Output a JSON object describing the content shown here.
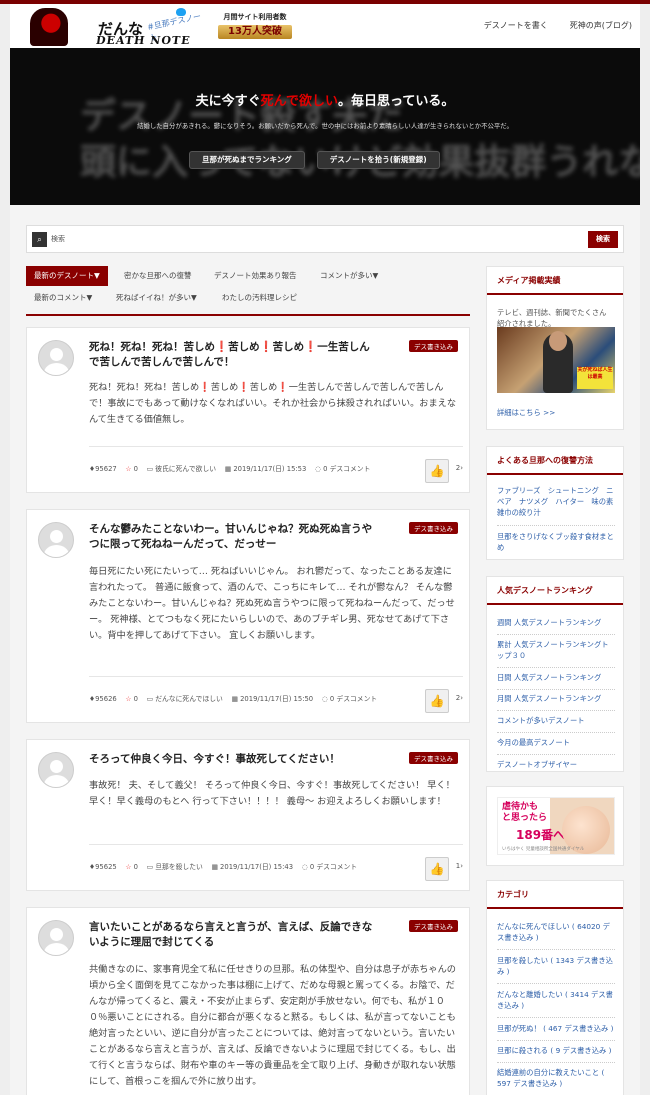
{
  "site": {
    "logo_line1": "だんな",
    "logo_line2": "DEATH NOTE",
    "logo_tag": "#旦那デスノート",
    "users_label": "月間サイト利用者数",
    "users_count": "13万人突破",
    "nav": [
      "デスノートを書く",
      "死神の声(ブログ)"
    ]
  },
  "hero": {
    "headline_pre": "夫に今すぐ",
    "headline_red": "死んで欲しい",
    "headline_post": "。毎日思っている。",
    "sub": "結婚した自分があきれる。鬱になりそう。お願いだから死んで。世の中にはお前より素晴らしい人達が生きられないとか不公平だ。",
    "ghost_line1": "デスノート殺す夫だ",
    "ghost_line2": "頭に入ってないけど効果抜群うれない",
    "btn_ranking": "旦那が死ぬまでランキング",
    "btn_register": "デスノートを拾う(新規登録)"
  },
  "search": {
    "placeholder": "検索",
    "button": "検索"
  },
  "tabs": [
    "最新のデスノート▼",
    "密かな旦那への復讐",
    "デスノート効果あり報告",
    "コメントが多い▼",
    "最新のコメント▼",
    "死ねばイイね！が多い▼",
    "わたしの汚料理レシピ"
  ],
  "posts": [
    {
      "title": "死ね！死ね！死ね！苦しめ❗苦しめ❗苦しめ❗一生苦しんで苦しんで苦しんで苦しんで！",
      "badge": "デス書き込み",
      "body": "死ね！死ね！死ね！苦しめ❗苦しめ❗苦しめ❗一生苦しんで苦しんで苦しんで苦しんで！事故にでもあって動けなくなればいい。それか社会から抹殺されればいい。おまえなんて生きてる価値無し。",
      "id": "95627",
      "stars": "0",
      "category": "彼氏に死んで欲しい",
      "date": "2019/11/17(日) 15:53",
      "comments": "0 デスコメント",
      "likes": "2"
    },
    {
      "title": "そんな鬱みたことないわー。甘いんじゃね？死ぬ死ぬ言うやつに限って死ねねーんだって、だっせー",
      "badge": "デス書き込み",
      "body": "毎日死にたい死にたいって… 死ねばいいじゃん。 おれ鬱だって、なったことある友達に言われたって。 普通に飯食って、酒のんで、こっちにキレて… それが鬱なん？ そんな鬱みたことないわー。甘いんじゃね？死ぬ死ぬ言うやつに限って死ねねーんだって、だっせー。 死神様、とてつもなく死にたいらしいので、あのブチギレ男、死なせてあげて下さい。背中を押してあげて下さい。 宜しくお願いします。",
      "id": "95626",
      "stars": "0",
      "category": "だんなに死んでほしい",
      "date": "2019/11/17(日) 15:50",
      "comments": "0 デスコメント",
      "likes": "2"
    },
    {
      "title": "そろって仲良く今日、今すぐ！事故死してください！",
      "badge": "デス書き込み",
      "body": "事故死！ 夫、そして義父！ そろって仲良く今日、今すぐ！事故死してください！ 早く！早く！早く義母のもとへ 行って下さい！！！！ 義母〜 お迎えよろしくお願いします！",
      "id": "95625",
      "stars": "0",
      "category": "旦那を殺したい",
      "date": "2019/11/17(日) 15:43",
      "comments": "0 デスコメント",
      "likes": "1"
    },
    {
      "title": "言いたいことがあるなら言えと言うが、言えば、反論できないように理屈で封じてくる",
      "badge": "デス書き込み",
      "body": "共働きなのに、家事育児全て私に任せきりの旦那。私の体型や、自分は息子が赤ちゃんの頃から全く面倒を見てこなかった事は棚に上げて、だめな母親と罵ってくる。お陰で、だんなが帰ってくると、震え・不安が止まらず、安定剤が手放せない。何でも、私が１００％悪いことにされる。自分に都合が悪くなると黙る。もしくは、私が言ってないことも絶対言ったといい、逆に自分が言ったことについては、絶対言ってないという。言いたいことがあるなら言えと言うが、言えば、反論できないように理屈で封じてくる。もし、出て行くと言うならば、財布や車のキー等の貴重品を全て取り上げ、身動きが取れない状態にして、首根っこを掴んで外に放り出す。"
    }
  ],
  "sidebar": {
    "media_title": "メディア掲載実績",
    "media_text": "テレビ、週刊誌、新聞でたくさん紹介されました。",
    "media_caption": "夫が死ねば人生は最高",
    "media_link": "詳細はこちら >>",
    "revenge_title": "よくある旦那への復讐方法",
    "revenge_items": [
      "ファブリーズ　シュートニング　ニベア　ナツメグ　ハイター　味の素　雑巾の絞り汁",
      "旦那をさりげなくブッ殺す食材まとめ"
    ],
    "ranking_title": "人気デスノートランキング",
    "ranking_items": [
      "週間 人気デスノートランキング",
      "累計 人気デスノートランキングトップ３０",
      "日間 人気デスノートランキング",
      "月間 人気デスノートランキング",
      "コメントが多いデスノート",
      "今月の最高デスノート",
      "デスノートオブザイヤー"
    ],
    "ad_line1": "虐待かも",
    "ad_line2": "と思ったら",
    "ad_number": "189番へ",
    "ad_small": "いちはやく 児童相談所全国共通ダイヤル",
    "cat_title": "カテゴリ",
    "cat_items": [
      "だんなに死んでほしい ( 64020 デス書き込み )",
      "旦那を殺したい ( 1343 デス書き込み )",
      "だんなと離婚したい ( 3414 デス書き込み )",
      "旦那が死ぬ！ ( 467 デス書き込み )",
      "旦那に殺される ( 9 デス書き込み )",
      "結婚連前の自分に教えたいこと ( 597 デス書き込み )"
    ]
  },
  "colors": {
    "accent": "#8a0000",
    "link": "#2c5ea8",
    "hero_bg": "#0b0b0b"
  }
}
